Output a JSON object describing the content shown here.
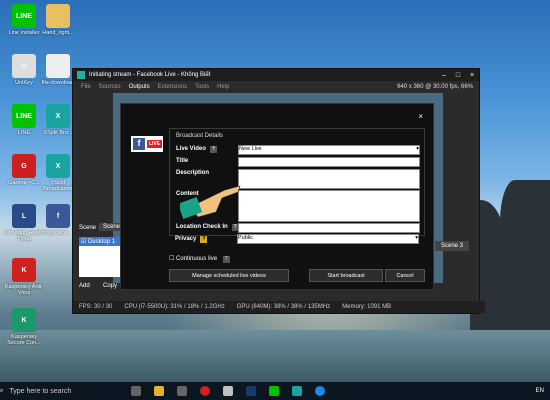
{
  "desktop": {
    "icons": [
      {
        "label": "Line installer",
        "name": "line-installer-icon",
        "text": "LINE",
        "color": "#00c300"
      },
      {
        "label": "Hand_right...",
        "name": "hand-file-icon",
        "text": "",
        "color": "#e8c060"
      },
      {
        "label": "UniKey",
        "name": "unikey-icon",
        "text": "U",
        "color": "#dddddd"
      },
      {
        "label": "file-download",
        "name": "file-icon",
        "text": "",
        "color": "#eeeeee"
      },
      {
        "label": "LINE",
        "name": "line-icon",
        "text": "LINE",
        "color": "#00c300"
      },
      {
        "label": "XSplit Bro...",
        "name": "xsplit-broadcaster-icon",
        "text": "X",
        "color": "#1aa3a3"
      },
      {
        "label": "Garena +C...",
        "name": "garena-icon",
        "text": "G",
        "color": "#cc2020"
      },
      {
        "label": "XSplit Broadcaster",
        "name": "xsplit-icon",
        "text": "X",
        "color": "#1aa3a3"
      },
      {
        "label": "Liên Minh Huyền Thoại",
        "name": "lol-icon",
        "text": "L",
        "color": "#2a4a8a"
      },
      {
        "label": "logo-face...",
        "name": "facebook-logo-icon",
        "text": "f",
        "color": "#3b5998"
      },
      {
        "label": "Kaspersky Anti-Virus",
        "name": "kaspersky-av-icon",
        "text": "K",
        "color": "#d02020"
      },
      {
        "label": "Kaspersky Secure Con...",
        "name": "kaspersky-secure-icon",
        "text": "K",
        "color": "#1a9a6a"
      }
    ]
  },
  "xsplit": {
    "title": "Initiating stream - Facebook Live - Không Biết",
    "menu": [
      "File",
      "Sources",
      "Outputs",
      "Extensions",
      "Tools",
      "Help"
    ],
    "resolution": "640 x 360 @ 30.00 fps, 66%",
    "scene_label": "Scene",
    "scene_name": "Scene",
    "source_item": "Desktop 1",
    "scene3": "Scene 3",
    "add": "Add",
    "copy": "Copy",
    "status": {
      "fps": "FPS: 30 / 30",
      "cpu": "CPU (i7-5500U): 31% / 18% / 1.2GHz",
      "gpu": "GPU (840M): 38% / 38% / 135MHz",
      "memory": "Memory: 1091 MB"
    }
  },
  "dialog": {
    "section": "Broadcast Details",
    "live_video_label": "Live Video",
    "live_video_value": "New Live",
    "title_label": "Title",
    "description_label": "Description",
    "content_label": "Content",
    "location_label": "Location Check In",
    "privacy_label": "Privacy",
    "privacy_value": "Public",
    "continuous_live": "Continuous live",
    "manage_btn": "Manage scheduled live videos",
    "start_btn": "Start broadcast",
    "cancel_btn": "Cancel",
    "fb_live": "LIVE"
  },
  "taskbar": {
    "search": "Type here to search",
    "time": "EN"
  }
}
